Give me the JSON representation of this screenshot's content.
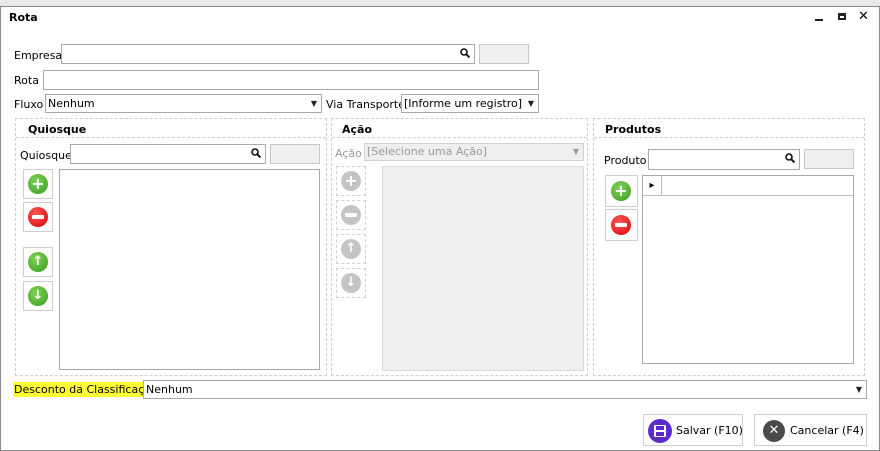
{
  "window": {
    "title": "Rota"
  },
  "form": {
    "empresa_label": "Empresa",
    "empresa_value": "",
    "rota_label": "Rota",
    "rota_value": "",
    "fluxo_label": "Fluxo",
    "fluxo_value": "Nenhum",
    "via_label": "Via Transporte",
    "via_value": "[Informe um registro]"
  },
  "quiosque": {
    "title": "Quiosque",
    "field_label": "Quiosque",
    "field_value": ""
  },
  "acao": {
    "title": "Ação",
    "field_label": "Ação",
    "field_value": "[Selecione uma Ação]"
  },
  "produtos": {
    "title": "Produtos",
    "field_label": "Produto",
    "field_value": "",
    "grid_indicator": "▸"
  },
  "desconto": {
    "label": "Desconto da Classificação",
    "value": "Nenhum"
  },
  "footer": {
    "save_label": "Salvar (F10)",
    "cancel_label": "Cancelar (F4)"
  },
  "icons": {
    "search": "search-icon",
    "add": "plus-circle-icon",
    "remove": "minus-circle-icon",
    "up": "arrow-up-icon",
    "down": "arrow-down-icon",
    "save": "floppy-disk-icon",
    "cancel": "cancel-x-icon"
  },
  "colors": {
    "add": "#3a9a1a",
    "remove": "#d40000",
    "highlight": "#ffff33",
    "save_icon": "#5a2bc9",
    "cancel_icon": "#4a4a4a"
  }
}
